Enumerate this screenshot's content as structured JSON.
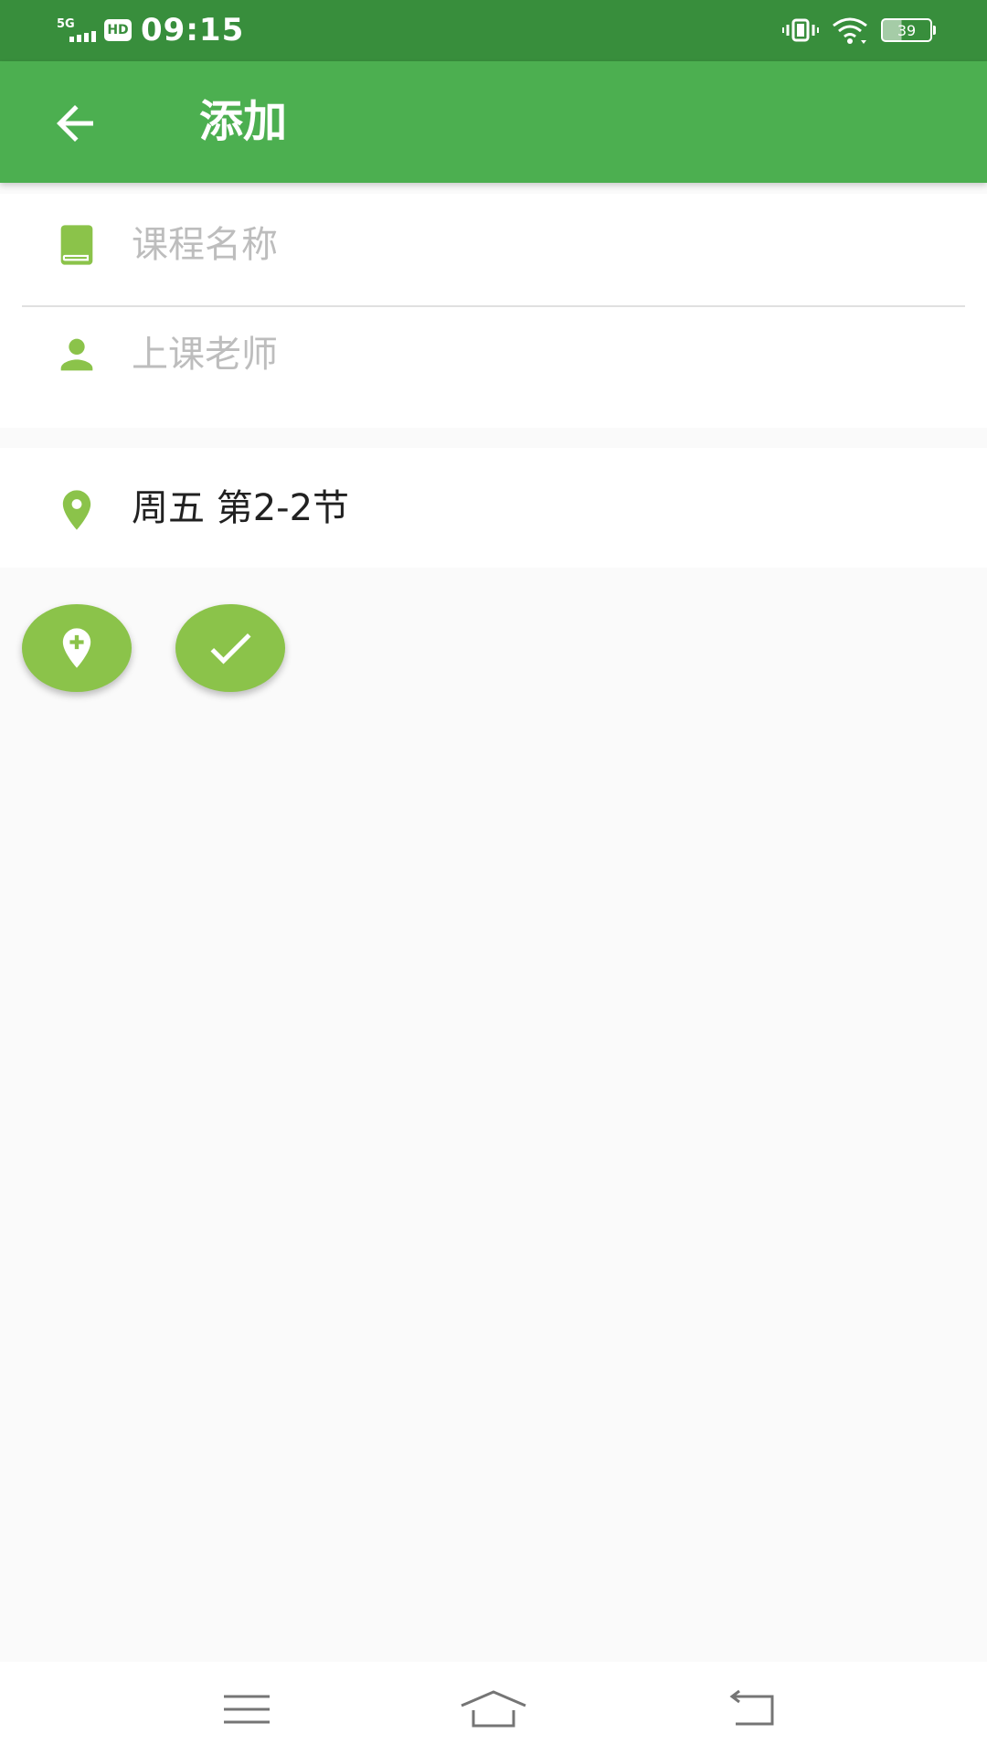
{
  "status_bar": {
    "network": "5G",
    "hd_badge": "HD",
    "time": "09:15",
    "battery_level": "39"
  },
  "app_bar": {
    "title": "添加"
  },
  "form": {
    "course_name": {
      "value": "",
      "placeholder": "课程名称"
    },
    "teacher": {
      "value": "",
      "placeholder": "上课老师"
    }
  },
  "schedule": {
    "time_label": "周五 第2-2节"
  },
  "colors": {
    "status_bar": "#388e3c",
    "app_bar": "#4caf50",
    "accent": "#8bc34a",
    "background": "#fafafa"
  },
  "icons": {
    "back": "arrow-back-icon",
    "course": "book-icon",
    "teacher": "person-icon",
    "location": "location-pin-icon",
    "add_location": "add-location-icon",
    "confirm": "check-icon"
  }
}
